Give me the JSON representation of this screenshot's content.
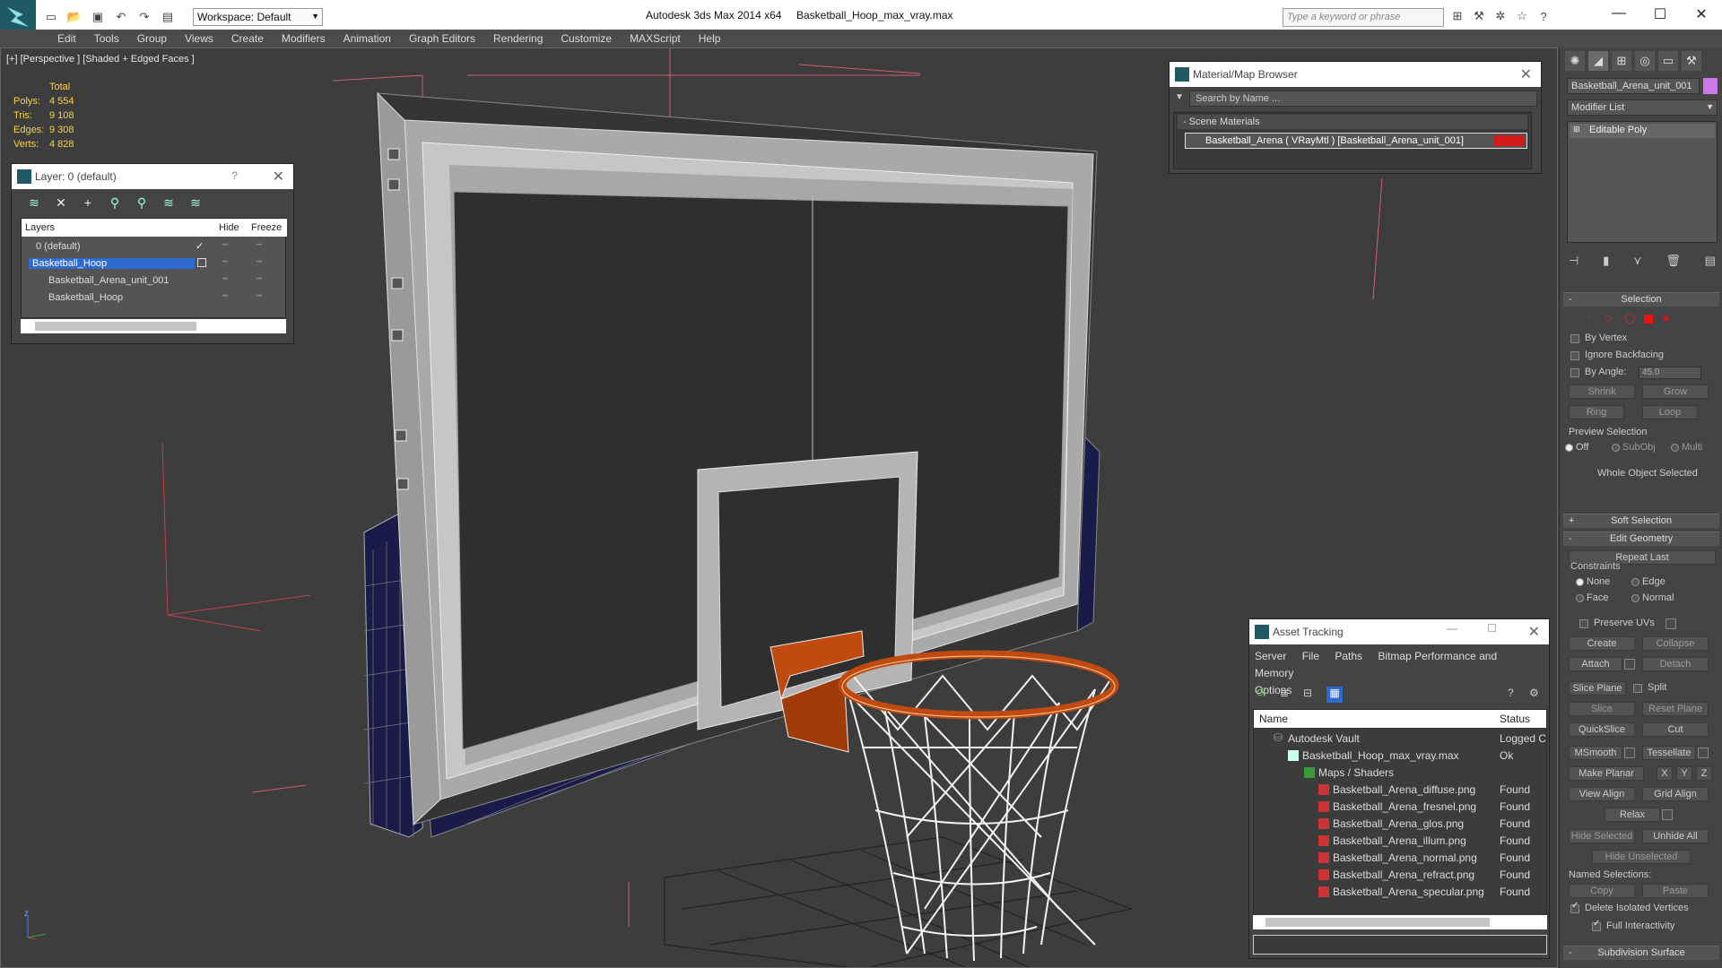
{
  "titlebar": {
    "workspace": "Workspace: Default",
    "app_title": "Autodesk 3ds Max  2014 x64",
    "file_title": "Basketball_Hoop_max_vray.max",
    "search_placeholder": "Type a keyword or phrase"
  },
  "menu": [
    "Edit",
    "Tools",
    "Group",
    "Views",
    "Create",
    "Modifiers",
    "Animation",
    "Graph Editors",
    "Rendering",
    "Customize",
    "MAXScript",
    "Help"
  ],
  "viewport": {
    "label": "[+] [Perspective ] [Shaded + Edged Faces ]",
    "stats": {
      "header": "Total",
      "rows": [
        {
          "k": "Polys:",
          "v": "4 554"
        },
        {
          "k": "Tris:",
          "v": "9 108"
        },
        {
          "k": "Edges:",
          "v": "9 308"
        },
        {
          "k": "Verts:",
          "v": "4 828"
        }
      ]
    },
    "axis_labels": {
      "z": "z",
      "y": "y",
      "x": "x"
    }
  },
  "layer_window": {
    "title": "Layer: 0 (default)",
    "help": "?",
    "columns": {
      "layers": "Layers",
      "hide": "Hide",
      "freeze": "Freeze"
    },
    "rows": [
      {
        "name": "0 (default)",
        "indent": 0,
        "selected": false
      },
      {
        "name": "Basketball_Hoop",
        "indent": 0,
        "selected": true
      },
      {
        "name": "Basketball_Arena_unit_001",
        "indent": 1,
        "selected": false
      },
      {
        "name": "Basketball_Hoop",
        "indent": 1,
        "selected": false
      }
    ]
  },
  "material_browser": {
    "title": "Material/Map Browser",
    "search_placeholder": "Search by Name ...",
    "group": "- Scene Materials",
    "item": "Basketball_Arena  ( VRayMtl ) [Basketball_Arena_unit_001]"
  },
  "asset_tracking": {
    "title": "Asset Tracking",
    "menu": [
      "Server",
      "File",
      "Paths",
      "Bitmap Performance and Memory",
      "Options"
    ],
    "columns": {
      "name": "Name",
      "status": "Status"
    },
    "rows": [
      {
        "name": "Autodesk Vault",
        "status": "Logged C",
        "indent": 0
      },
      {
        "name": "Basketball_Hoop_max_vray.max",
        "status": "Ok",
        "indent": 1
      },
      {
        "name": "Maps / Shaders",
        "status": "",
        "indent": 2
      },
      {
        "name": "Basketball_Arena_diffuse.png",
        "status": "Found",
        "indent": 3
      },
      {
        "name": "Basketball_Arena_fresnel.png",
        "status": "Found",
        "indent": 3
      },
      {
        "name": "Basketball_Arena_glos.png",
        "status": "Found",
        "indent": 3
      },
      {
        "name": "Basketball_Arena_illum.png",
        "status": "Found",
        "indent": 3
      },
      {
        "name": "Basketball_Arena_normal.png",
        "status": "Found",
        "indent": 3
      },
      {
        "name": "Basketball_Arena_refract.png",
        "status": "Found",
        "indent": 3
      },
      {
        "name": "Basketball_Arena_specular.png",
        "status": "Found",
        "indent": 3
      }
    ]
  },
  "command_panel": {
    "object_name": "Basketball_Arena_unit_001",
    "modifier_list": "Modifier List",
    "stack_item": "Editable Poly",
    "selection": {
      "title": "Selection",
      "by_vertex": "By Vertex",
      "ignore_backfacing": "Ignore Backfacing",
      "by_angle": "By Angle:",
      "angle_value": "45.0",
      "shrink": "Shrink",
      "grow": "Grow",
      "ring": "Ring",
      "loop": "Loop",
      "preview_selection": "Preview Selection",
      "off": "Off",
      "subobj": "SubObj",
      "multi": "Multi",
      "status": "Whole Object Selected"
    },
    "soft_selection": "Soft Selection",
    "edit_geometry": {
      "title": "Edit Geometry",
      "repeat_last": "Repeat Last",
      "constraints": "Constraints",
      "none": "None",
      "edge": "Edge",
      "face": "Face",
      "normal": "Normal",
      "preserve_uvs": "Preserve UVs",
      "create": "Create",
      "collapse": "Collapse",
      "attach": "Attach",
      "detach": "Detach",
      "slice_plane": "Slice Plane",
      "split": "Split",
      "slice": "Slice",
      "reset_plane": "Reset Plane",
      "quickslice": "QuickSlice",
      "cut": "Cut",
      "msmooth": "MSmooth",
      "tessellate": "Tessellate",
      "make_planar": "Make Planar",
      "x": "X",
      "y": "Y",
      "z": "Z",
      "view_align": "View Align",
      "grid_align": "Grid Align",
      "relax": "Relax",
      "hide_selected": "Hide Selected",
      "unhide_all": "Unhide All",
      "hide_unselected": "Hide Unselected",
      "named_selections": "Named Selections:",
      "copy": "Copy",
      "paste": "Paste",
      "delete_isolated": "Delete Isolated Vertices",
      "full_interactivity": "Full Interactivity"
    },
    "subdivision_surface": "Subdivision Surface"
  }
}
